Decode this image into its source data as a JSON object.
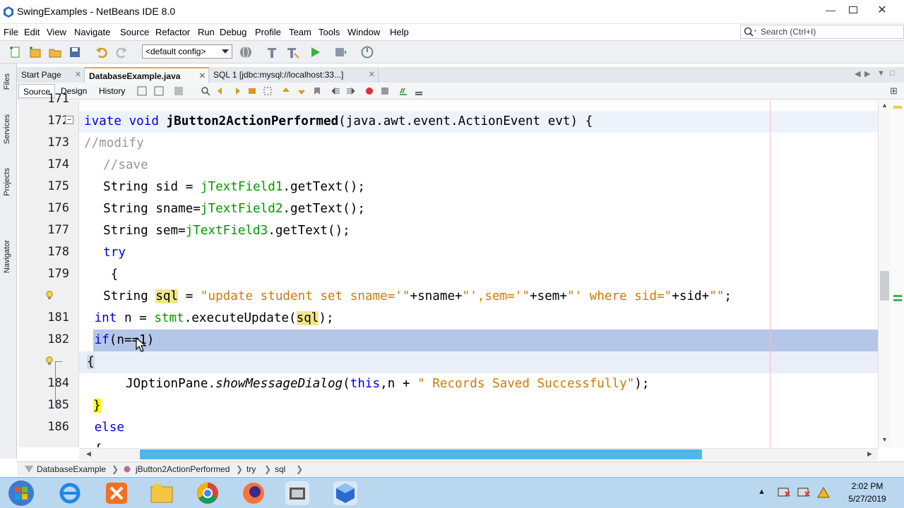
{
  "window": {
    "title": "SwingExamples - NetBeans IDE 8.0"
  },
  "menu": [
    "File",
    "Edit",
    "View",
    "Navigate",
    "Source",
    "Refactor",
    "Run",
    "Debug",
    "Profile",
    "Team",
    "Tools",
    "Window",
    "Help"
  ],
  "search": {
    "placeholder": "Search (Ctrl+I)"
  },
  "toolbar": {
    "config_value": "<default config>"
  },
  "side_tabs": [
    "Files",
    "Services",
    "Projects",
    "Navigator"
  ],
  "tabs": [
    {
      "label": "Start Page"
    },
    {
      "label": "DatabaseExample.java"
    },
    {
      "label": "SQL 1 [jdbc:mysql://localhost:33...]"
    }
  ],
  "editor_tabs": [
    "Source",
    "Design",
    "History"
  ],
  "gutter": {
    "lines": [
      "171",
      "172",
      "173",
      "174",
      "175",
      "176",
      "177",
      "178",
      "179",
      "",
      "181",
      "182",
      "",
      "184",
      "185",
      "186",
      ""
    ]
  },
  "code": {
    "l171": "",
    "l172_a": "ivate ",
    "l172_b": "void ",
    "l172_c": "jButton2ActionPerformed",
    "l172_d": "(java.awt.event.ActionEvent evt) {",
    "l173": "//modify",
    "l174": "  //save",
    "l175_a": "  String sid = ",
    "l175_b": "jTextField1",
    "l175_c": ".getText();",
    "l176_a": "  String sname=",
    "l176_b": "jTextField2",
    "l176_c": ".getText();",
    "l177_a": "  String sem=",
    "l177_b": "jTextField3",
    "l177_c": ".getText();",
    "l178": "  try",
    "l179": "   {",
    "l180_a": "  String ",
    "l180_b": "sql",
    "l180_c": " = ",
    "l180_d": "\"update student set sname='\"",
    "l180_e": "+sname+",
    "l180_f": "\"',sem='\"",
    "l180_g": "+sem+",
    "l180_h": "\"' where sid=\"",
    "l180_i": "+sid+",
    "l180_j": "\"\"",
    "l180_k": ";",
    "l181_a": " int ",
    "l181_b": "n = ",
    "l181_c": "stmt",
    "l181_d": ".executeUpdate(",
    "l181_e": "sql",
    "l181_f": ");",
    "l182_a": " if",
    "l182_b": "(n==1)",
    "l183": "{",
    "l184_a": "     JOptionPane.",
    "l184_b": "showMessageDialog",
    "l184_c": "(",
    "l184_d": "this",
    "l184_e": ",n + ",
    "l184_f": "\" Records Saved Successfully\"",
    "l184_g": ");",
    "l185": "}",
    "l186": " else",
    "l187": " {"
  },
  "breadcrumbs": [
    "DatabaseExample",
    "jButton2ActionPerformed",
    "try",
    "sql"
  ],
  "clock": {
    "time": "2:02 PM",
    "date": "5/27/2019"
  },
  "colors": {
    "keyword": "#0000e6",
    "string": "#ce7b00",
    "comment": "#969696",
    "field": "#009900",
    "selection": "#b5c7e9",
    "tab_accent": "#f5a623"
  }
}
